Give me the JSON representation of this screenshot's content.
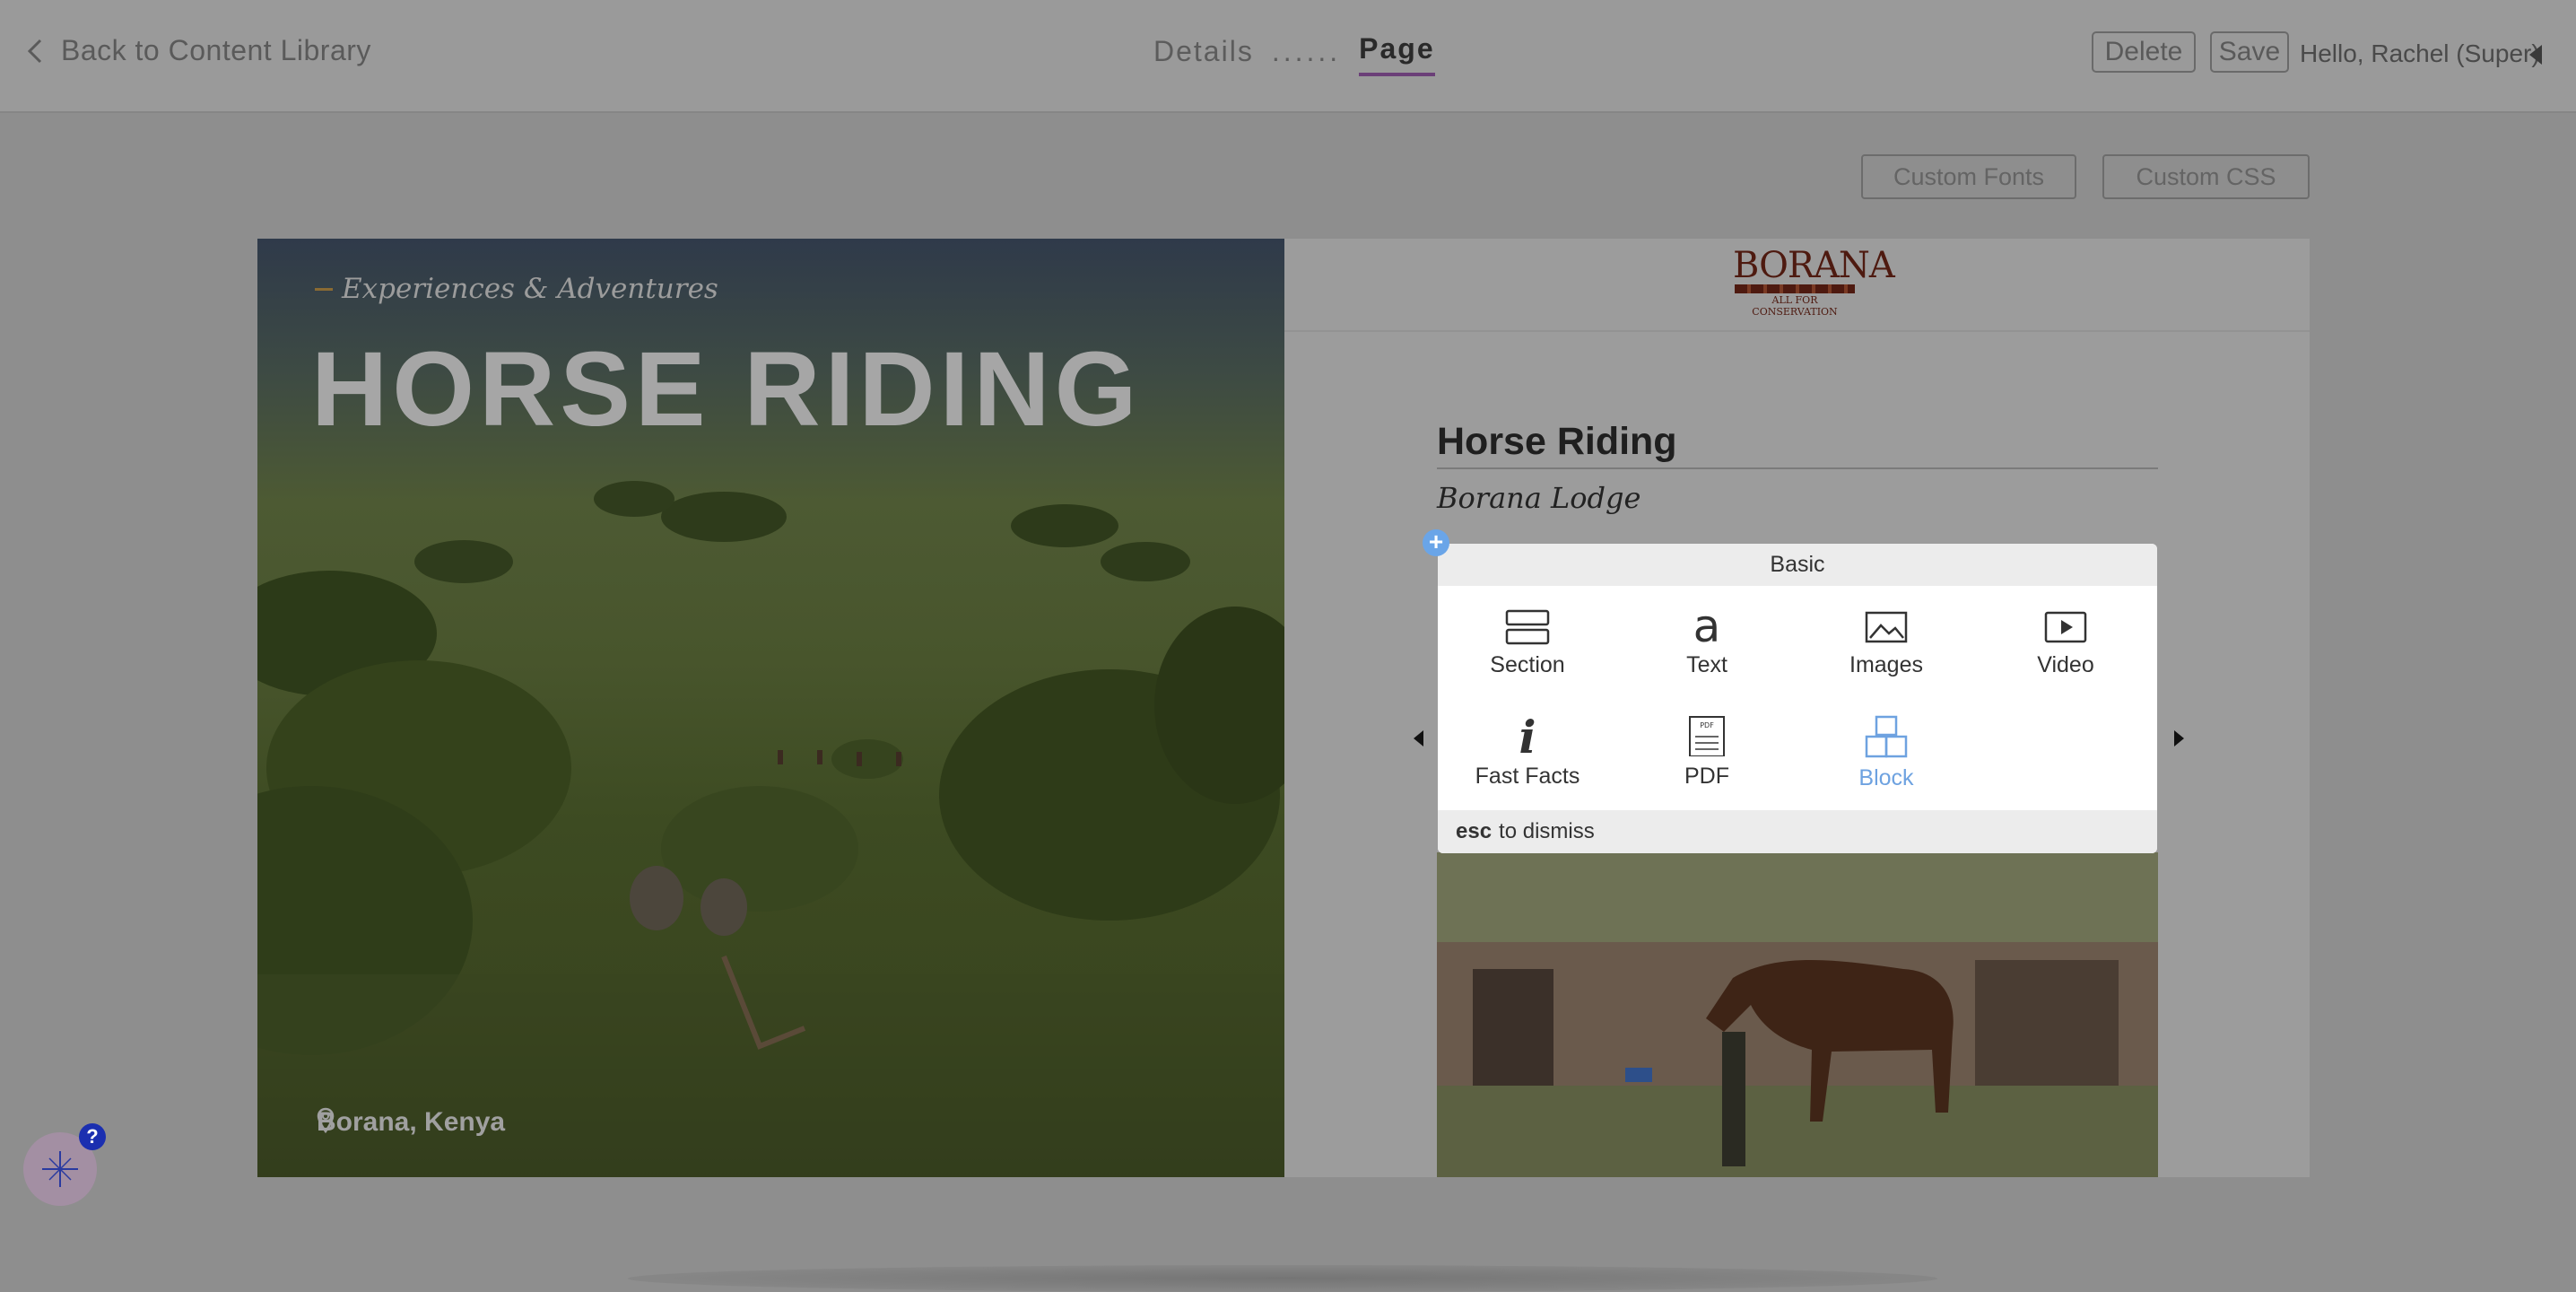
{
  "header": {
    "back_label": "Back to Content Library",
    "steps": [
      "Details",
      "......",
      "Page"
    ],
    "delete_label": "Delete",
    "save_label": "Save",
    "greeting": "Hello, Rachel (Super)"
  },
  "toolbar": {
    "custom_fonts_label": "Custom Fonts",
    "custom_css_label": "Custom CSS"
  },
  "hero": {
    "kicker": "Experiences & Adventures",
    "title": "HORSE RIDING",
    "location": "Borana, Kenya"
  },
  "brand": {
    "logo_text": "BORANA",
    "logo_tagline": "ALL FOR CONSERVATION"
  },
  "document": {
    "title": "Horse Riding",
    "subtitle": "Borana Lodge"
  },
  "insert_menu": {
    "heading": "Basic",
    "items": [
      {
        "label": "Section",
        "icon": "section-icon"
      },
      {
        "label": "Text",
        "icon": "text-icon"
      },
      {
        "label": "Images",
        "icon": "images-icon"
      },
      {
        "label": "Video",
        "icon": "video-icon"
      },
      {
        "label": "Fast Facts",
        "icon": "info-icon"
      },
      {
        "label": "PDF",
        "icon": "pdf-icon"
      },
      {
        "label": "Block",
        "icon": "block-icon",
        "selected": true
      }
    ],
    "dismiss_key": "esc",
    "dismiss_text": "to dismiss"
  },
  "help": {
    "badge": "?"
  },
  "colors": {
    "accent_purple": "#6b3f78",
    "selection_blue": "#6ea2e0",
    "help_badge": "#1b2fb0",
    "logo_brown": "#4e1a10"
  }
}
